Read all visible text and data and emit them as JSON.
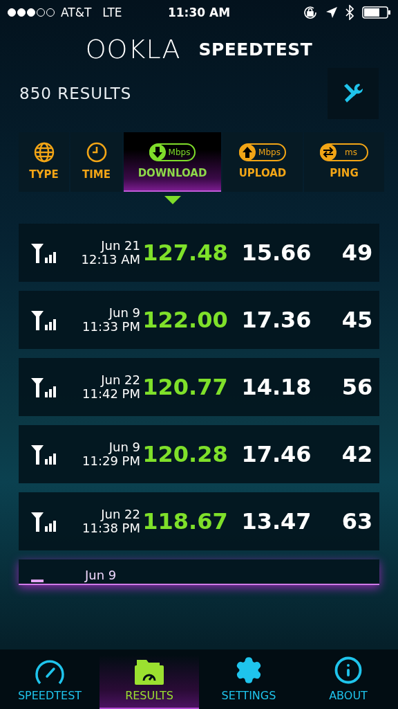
{
  "status_bar": {
    "carrier": "AT&T",
    "network": "LTE",
    "time": "11:30 AM"
  },
  "header": {
    "logo": "OOKLA",
    "product": "SPEEDTEST"
  },
  "results_count": "850 RESULTS",
  "sort_columns": [
    {
      "kind": "globe",
      "label": "TYPE",
      "selected": false
    },
    {
      "kind": "clock",
      "label": "TIME",
      "selected": false
    },
    {
      "kind": "download",
      "label": "DOWNLOAD",
      "unit": "Mbps",
      "selected": true
    },
    {
      "kind": "upload",
      "label": "UPLOAD",
      "unit": "Mbps",
      "selected": false
    },
    {
      "kind": "ping",
      "label": "PING",
      "unit": "ms",
      "selected": false
    }
  ],
  "results": [
    {
      "date": "Jun 21",
      "time": "12:13 AM",
      "download": "127.48",
      "upload": "15.66",
      "ping": "49"
    },
    {
      "date": "Jun 9",
      "time": "11:33 PM",
      "download": "122.00",
      "upload": "17.36",
      "ping": "45"
    },
    {
      "date": "Jun 22",
      "time": "11:42 PM",
      "download": "120.77",
      "upload": "14.18",
      "ping": "56"
    },
    {
      "date": "Jun 9",
      "time": "11:29 PM",
      "download": "120.28",
      "upload": "17.46",
      "ping": "42"
    },
    {
      "date": "Jun 22",
      "time": "11:38 PM",
      "download": "118.67",
      "upload": "13.47",
      "ping": "63"
    }
  ],
  "partial_result": {
    "date": "Jun 9"
  },
  "tabs": [
    {
      "kind": "gauge",
      "label": "SPEEDTEST",
      "selected": false
    },
    {
      "kind": "folder",
      "label": "RESULTS",
      "selected": true
    },
    {
      "kind": "gear",
      "label": "SETTINGS",
      "selected": false
    },
    {
      "kind": "info",
      "label": "ABOUT",
      "selected": false
    }
  ]
}
